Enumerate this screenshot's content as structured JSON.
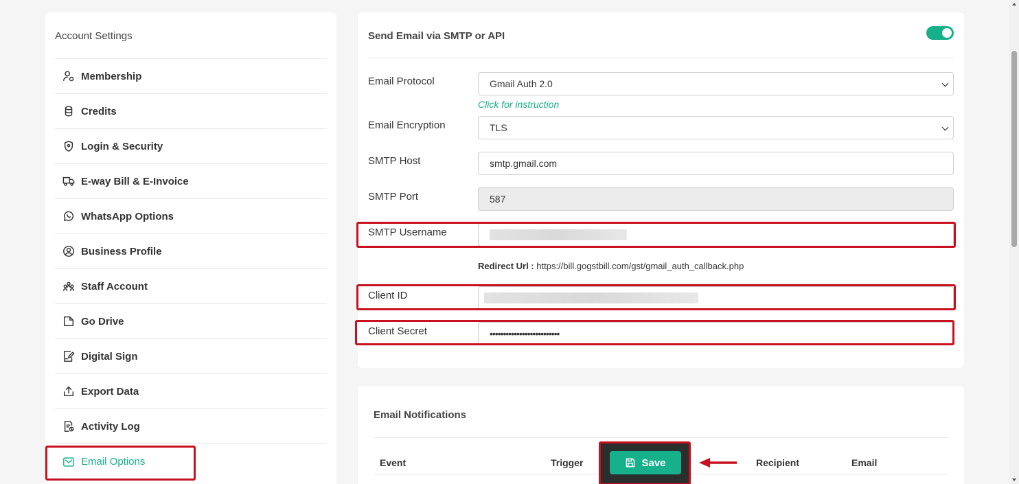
{
  "sidebar": {
    "title": "Account Settings",
    "items": [
      {
        "label": "Membership",
        "icon": "user-badge-icon"
      },
      {
        "label": "Credits",
        "icon": "coins-icon"
      },
      {
        "label": "Login & Security",
        "icon": "shield-icon"
      },
      {
        "label": "E-way Bill & E-Invoice",
        "icon": "truck-icon"
      },
      {
        "label": "WhatsApp Options",
        "icon": "whatsapp-icon"
      },
      {
        "label": "Business Profile",
        "icon": "user-circle-icon"
      },
      {
        "label": "Staff Account",
        "icon": "users-icon"
      },
      {
        "label": "Go Drive",
        "icon": "folder-icon"
      },
      {
        "label": "Digital Sign",
        "icon": "signature-icon"
      },
      {
        "label": "Export Data",
        "icon": "upload-icon"
      },
      {
        "label": "Activity Log",
        "icon": "log-icon"
      },
      {
        "label": "Email Options",
        "icon": "mail-icon",
        "active": true
      }
    ]
  },
  "smtp": {
    "title": "Send Email via SMTP or API",
    "enabled": true,
    "protocol_label": "Email Protocol",
    "protocol_value": "Gmail Auth 2.0",
    "instruction_link": "Click for instruction",
    "encryption_label": "Email Encryption",
    "encryption_value": "TLS",
    "host_label": "SMTP Host",
    "host_value": "smtp.gmail.com",
    "port_label": "SMTP Port",
    "port_value": "587",
    "username_label": "SMTP Username",
    "redirect_label": "Redirect Url :",
    "redirect_value": "https://bill.gogstbill.com/gst/gmail_auth_callback.php",
    "client_id_label": "Client ID",
    "client_secret_label": "Client Secret",
    "client_secret_value": "••••••••••••••••••••••••••"
  },
  "notifications": {
    "title": "Email Notifications",
    "columns": [
      "Event",
      "Trigger",
      "Recipient",
      "Email"
    ]
  },
  "save_label": "Save",
  "colors": {
    "accent": "#16b08a",
    "highlight": "#c8101e"
  }
}
